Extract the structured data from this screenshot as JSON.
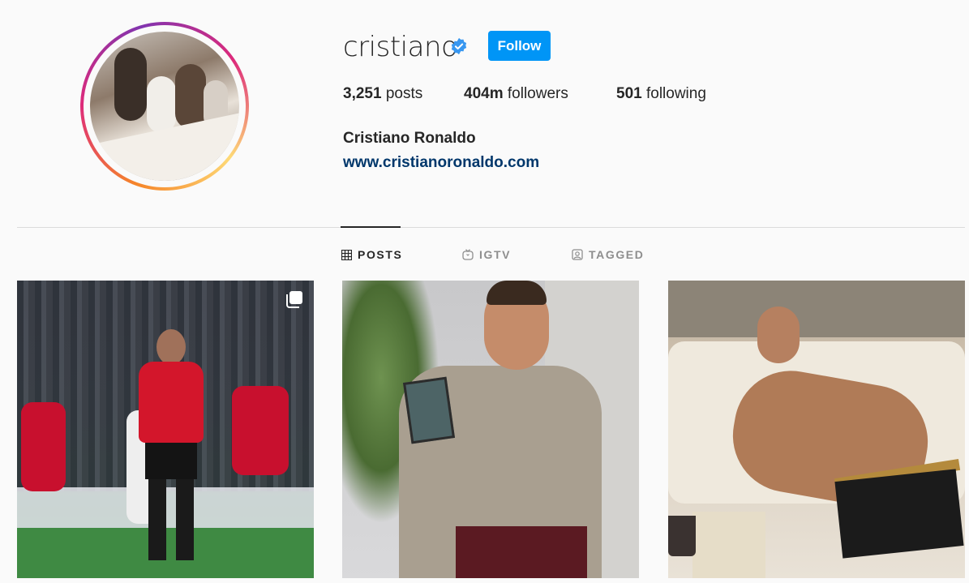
{
  "profile": {
    "username": "cristiano",
    "verified": true,
    "follow_label": "Follow",
    "full_name": "Cristiano Ronaldo",
    "website": "www.cristianoronaldo.com",
    "stats": {
      "posts_count": "3,251",
      "posts_label": "posts",
      "followers_count": "404m",
      "followers_label": "followers",
      "following_count": "501",
      "following_label": "following"
    }
  },
  "tabs": [
    {
      "label": "POSTS",
      "icon": "grid-icon",
      "active": true
    },
    {
      "label": "IGTV",
      "icon": "igtv-icon",
      "active": false
    },
    {
      "label": "TAGGED",
      "icon": "tagged-icon",
      "active": false
    }
  ],
  "posts": [
    {
      "icon": "carousel-icon"
    },
    {},
    {}
  ],
  "colors": {
    "follow_button": "#0095f6",
    "verified_badge": "#3897f0",
    "link": "#00376b",
    "background": "#fafafa"
  }
}
